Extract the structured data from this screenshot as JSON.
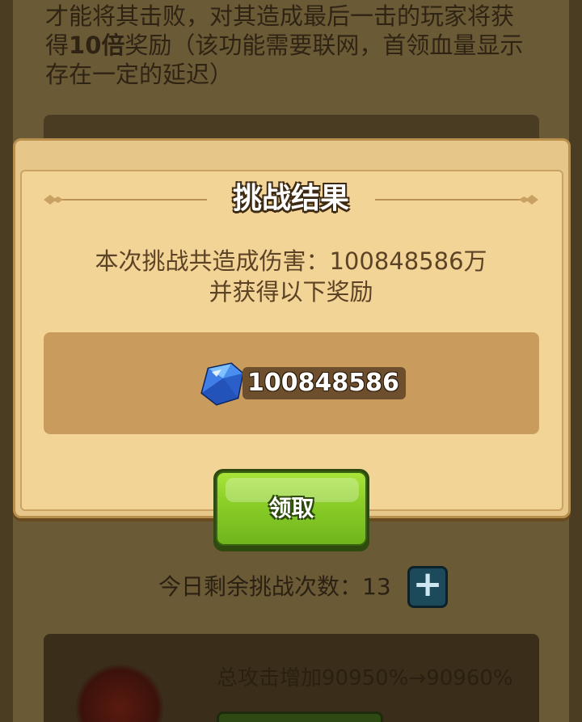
{
  "background": {
    "description_lines": [
      "才能将其击败，对其造成最后一击的玩家将获",
      "得",
      "10倍",
      "奖励（该功能需要联网，首领血量显示",
      "存在一定的延迟）"
    ],
    "remaining_label": "今日剩余挑战次数：13",
    "plus_label": "+",
    "bonus_text": "总攻击增加90950%→90960%"
  },
  "dialog": {
    "title": "挑战结果",
    "message_line1": "本次挑战共造成伤害：100848586万",
    "message_line2": "并获得以下奖励",
    "reward": {
      "icon": "blue-gem-icon",
      "amount": "100848586"
    },
    "claim_label": "领取"
  },
  "colors": {
    "dialog_bg": "#f3d497",
    "reward_box": "#c99c5e",
    "claim_button": "#8fd12a"
  }
}
